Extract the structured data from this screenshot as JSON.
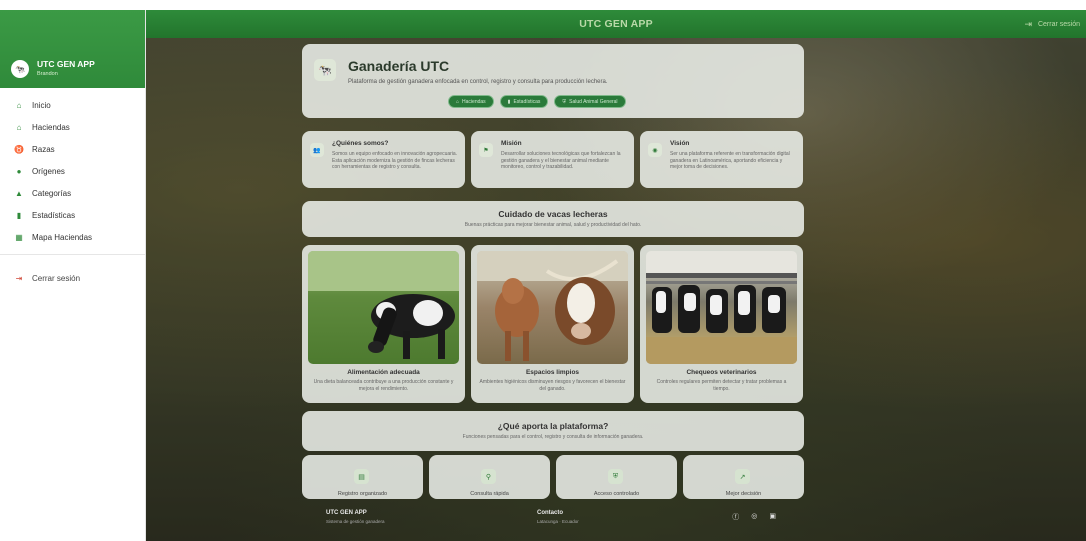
{
  "topbar": {
    "title": "UTC GEN APP",
    "logout_label": "Cerrar sesión"
  },
  "sidebar": {
    "app_name": "UTC GEN APP",
    "user": "Brandon",
    "items": [
      {
        "label": "Inicio",
        "icon": "home-icon",
        "glyph": "⌂"
      },
      {
        "label": "Haciendas",
        "icon": "barn-icon",
        "glyph": "⌂"
      },
      {
        "label": "Razas",
        "icon": "cow-icon",
        "glyph": "♉"
      },
      {
        "label": "Orígenes",
        "icon": "location-pin-icon",
        "glyph": "⬤"
      },
      {
        "label": "Categorías",
        "icon": "category-icon",
        "glyph": "▲"
      },
      {
        "label": "Estadísticas",
        "icon": "bar-chart-icon",
        "glyph": "▮"
      },
      {
        "label": "Mapa Haciendas",
        "icon": "map-icon",
        "glyph": "▦"
      }
    ],
    "logout_label": "Cerrar sesión"
  },
  "hero": {
    "title": "Ganadería UTC",
    "subtitle": "Plataforma de gestión ganadera enfocada en control, registro y consulta para producción lechera.",
    "buttons": [
      "Haciendas",
      "Estadísticas",
      "Salud Animal General"
    ]
  },
  "info": [
    {
      "title": "¿Quiénes somos?",
      "text": "Somos un equipo enfocado en innovación agropecuaria. Esta aplicación moderniza la gestión de fincas lecheras con herramientas de registro y consulta."
    },
    {
      "title": "Misión",
      "text": "Desarrollar soluciones tecnológicas que fortalezcan la gestión ganadera y el bienestar animal mediante monitoreo, control y trazabilidad."
    },
    {
      "title": "Visión",
      "text": "Ser una plataforma referente en transformación digital ganadera en Latinoamérica, aportando eficiencia y mejor toma de decisiones."
    }
  ],
  "care_section": {
    "title": "Cuidado de vacas lecheras",
    "subtitle": "Buenas prácticas para mejorar bienestar animal, salud y productividad del hato."
  },
  "care": [
    {
      "title": "Alimentación adecuada",
      "text": "Una dieta balanceada contribuye a una producción constante y mejora el rendimiento."
    },
    {
      "title": "Espacios limpios",
      "text": "Ambientes higiénicos disminuyen riesgos y favorecen el bienestar del ganado."
    },
    {
      "title": "Chequeos veterinarios",
      "text": "Controles regulares permiten detectar y tratar problemas a tiempo."
    }
  ],
  "features_section": {
    "title": "¿Qué aporta la plataforma?",
    "subtitle": "Funciones pensadas para el control, registro y consulta de información ganadera."
  },
  "features": [
    {
      "label": "Registro organizado",
      "icon": "clipboard-icon",
      "glyph": "▤"
    },
    {
      "label": "Consulta rápida",
      "icon": "search-icon",
      "glyph": "⚲"
    },
    {
      "label": "Acceso controlado",
      "icon": "shield-icon",
      "glyph": "⛨"
    },
    {
      "label": "Mejor decisión",
      "icon": "trend-icon",
      "glyph": "↗"
    }
  ],
  "footer": {
    "app": "UTC GEN APP",
    "app_sub": "Sistema de gestión ganadera",
    "contact": "Contacto",
    "contact_sub": "Latacunga · Ecuador",
    "social": [
      "facebook-icon",
      "instagram-icon",
      "camera-icon"
    ]
  }
}
